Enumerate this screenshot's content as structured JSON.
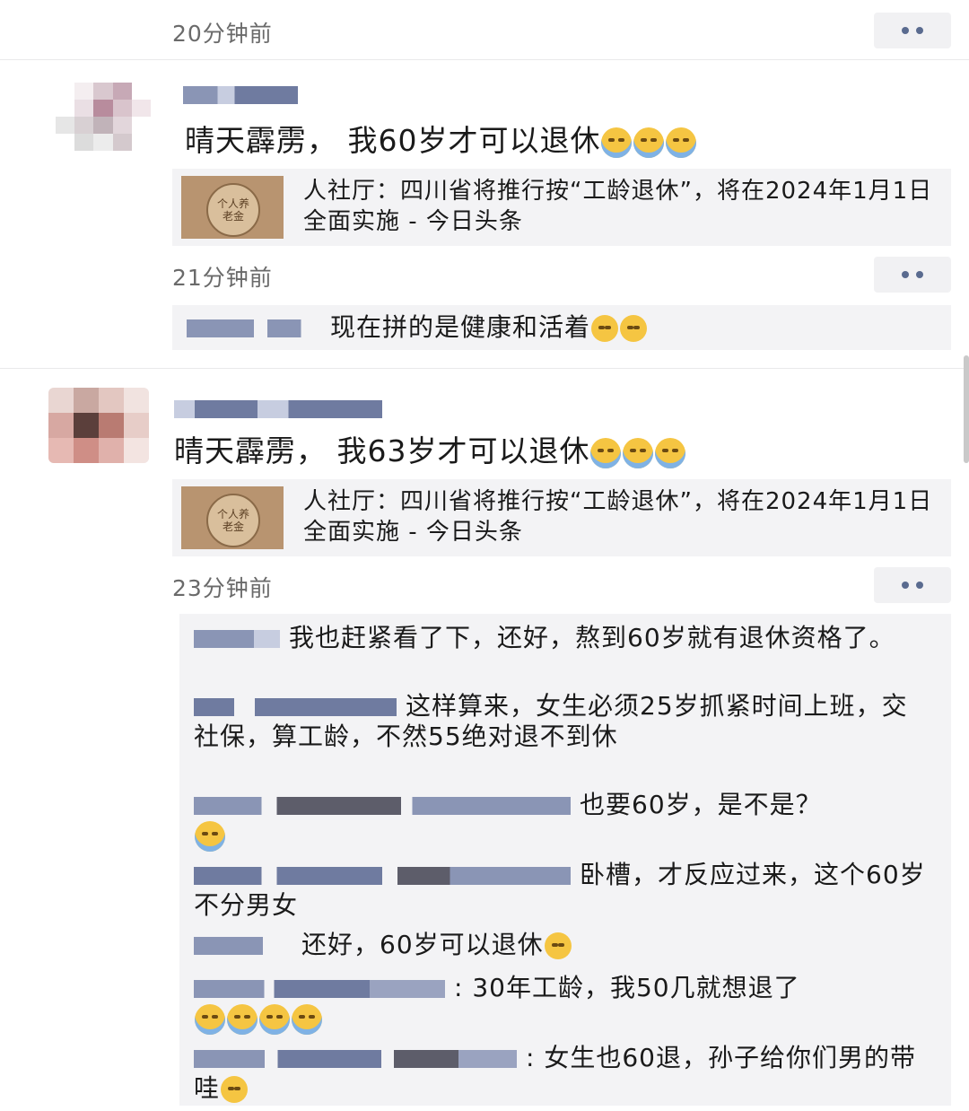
{
  "feed": {
    "top_time": "20分钟前",
    "posts": [
      {
        "author": "",
        "text": "晴天霹雳， 我60岁才可以退休",
        "link_title": "人社厅：四川省将推行按“工龄退休”，将在2024年1月1日全面实施 - 今日头条",
        "thumb_text": "个人养老金",
        "time": "21分钟前",
        "comments": [
          {
            "name": "",
            "text": "现在拼的是健康和活着"
          }
        ]
      },
      {
        "author": "",
        "text": "晴天霹雳， 我63岁才可以退休",
        "link_title": "人社厅：四川省将推行按“工龄退休”，将在2024年1月1日全面实施 - 今日头条",
        "thumb_text": "个人养老金",
        "time": "23分钟前",
        "comments": [
          {
            "name": "",
            "text": "我也赶紧看了下，还好，熬到60岁就有退休资格了。"
          },
          {
            "name": "",
            "text": "这样算来，女生必须25岁抓紧时间上班，交社保，算工龄，不然55绝对退不到休"
          },
          {
            "name": "",
            "text": "也要60岁，是不是？"
          },
          {
            "name": "",
            "text": "卧槽，才反应过来，这个60岁不分男女"
          },
          {
            "name": "",
            "text": "还好，60岁可以退休"
          },
          {
            "name": "",
            "text": ": 30年工龄，我50几就想退了"
          },
          {
            "name": "",
            "text": ": 女生也60退，孙子给你们男的带哇"
          }
        ]
      }
    ]
  },
  "icons": {
    "more": "more-dots-icon",
    "cry": "crying-emoji-icon",
    "laugh": "laughing-emoji-icon",
    "grin": "grin-emoji-icon"
  },
  "colors": {
    "link_blue": "#5a6b8f",
    "card_bg": "#f3f3f5",
    "time_gray": "#6a6a6a"
  }
}
